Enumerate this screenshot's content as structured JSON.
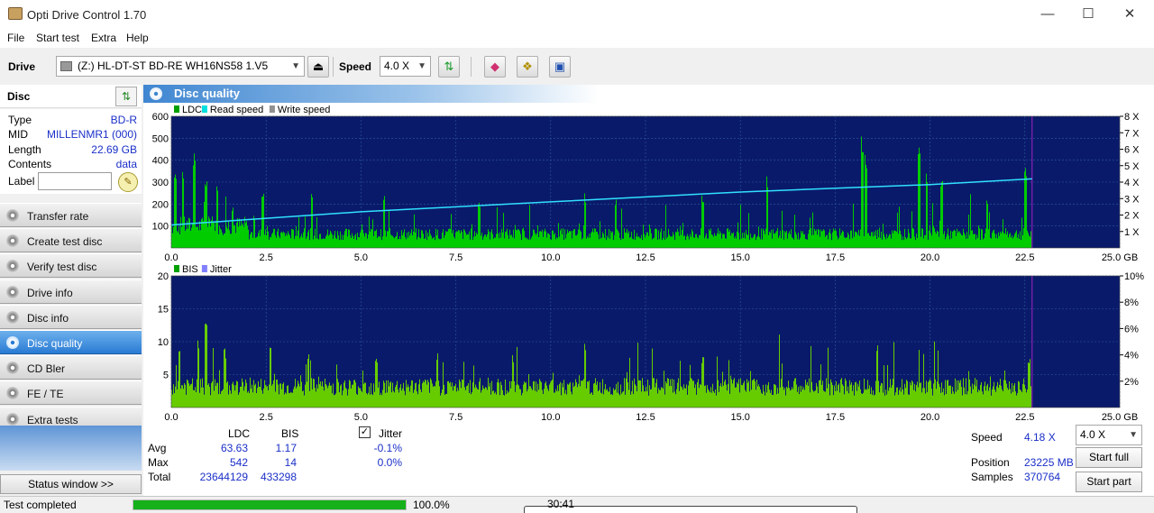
{
  "window": {
    "title": "Opti Drive Control 1.70",
    "minimize": "—",
    "maximize": "☐",
    "close": "✕"
  },
  "menu": [
    "File",
    "Start test",
    "Extra",
    "Help"
  ],
  "toolbar": {
    "drive_label": "Drive",
    "drive_value": "(Z:)   HL-DT-ST BD-RE  WH16NS58 1.V5",
    "speed_label": "Speed",
    "speed_value": "4.0 X",
    "icons": [
      "eject-icon",
      "refresh-icon",
      "eraser-icon",
      "copy-icon",
      "save-icon"
    ]
  },
  "disc": {
    "header": "Disc",
    "type_label": "Type",
    "type": "BD-R",
    "mid_label": "MID",
    "mid": "MILLENMR1 (000)",
    "length_label": "Length",
    "length": "22.69 GB",
    "contents_label": "Contents",
    "contents": "data",
    "label_label": "Label",
    "label_value": ""
  },
  "nav": [
    {
      "label": "Transfer rate",
      "active": false
    },
    {
      "label": "Create test disc",
      "active": false
    },
    {
      "label": "Verify test disc",
      "active": false
    },
    {
      "label": "Drive info",
      "active": false
    },
    {
      "label": "Disc info",
      "active": false
    },
    {
      "label": "Disc quality",
      "active": true
    },
    {
      "label": "CD Bler",
      "active": false
    },
    {
      "label": "FE / TE",
      "active": false
    },
    {
      "label": "Extra tests",
      "active": false
    }
  ],
  "status_window_button": "Status window >>",
  "panel_title": "Disc quality",
  "chart_data": [
    {
      "type": "area",
      "legend": [
        "LDC",
        "Read speed",
        "Write speed"
      ],
      "legend_colors": [
        "#00a000",
        "#00e0e0",
        "#909090"
      ],
      "x_ticks": [
        "0.0",
        "2.5",
        "5.0",
        "7.5",
        "10.0",
        "12.5",
        "15.0",
        "17.5",
        "20.0",
        "22.5",
        "25.0 GB"
      ],
      "y_ticks_left": [
        "600",
        "500",
        "400",
        "300",
        "200",
        "100"
      ],
      "y_ticks_right": [
        "8 X",
        "7 X",
        "6 X",
        "5 X",
        "4 X",
        "3 X",
        "2 X",
        "1 X"
      ],
      "xlim": [
        0,
        25
      ],
      "ylim": [
        0,
        600
      ],
      "y2lim": [
        0,
        8
      ],
      "data_end_gb": 22.69,
      "ldc_baseline": 60,
      "ldc_spikes": [
        [
          0.1,
          350
        ],
        [
          0.3,
          380
        ],
        [
          0.6,
          460
        ],
        [
          0.9,
          330
        ],
        [
          1.2,
          290
        ],
        [
          1.6,
          210
        ],
        [
          2.4,
          260
        ],
        [
          3.7,
          250
        ],
        [
          5.6,
          260
        ],
        [
          8.1,
          220
        ],
        [
          10.9,
          250
        ],
        [
          11.7,
          230
        ],
        [
          14.0,
          240
        ],
        [
          15.7,
          330
        ],
        [
          18.2,
          540
        ],
        [
          18.3,
          450
        ],
        [
          19.7,
          490
        ],
        [
          19.9,
          360
        ],
        [
          20.3,
          340
        ],
        [
          21.5,
          250
        ],
        [
          22.5,
          370
        ]
      ],
      "read_speed": [
        [
          0,
          1.4
        ],
        [
          5,
          2.2
        ],
        [
          10,
          2.8
        ],
        [
          15,
          3.4
        ],
        [
          20,
          3.85
        ],
        [
          22.69,
          4.2
        ]
      ],
      "colors": {
        "plot_bg": "#0a1a6a",
        "grid": "#2a5aa0",
        "ldc": "#00cc00",
        "read": "#30e0ff",
        "end_marker": "#a020c0"
      }
    },
    {
      "type": "area",
      "legend": [
        "BIS",
        "Jitter"
      ],
      "legend_colors": [
        "#00a000",
        "#8080ff"
      ],
      "x_ticks": [
        "0.0",
        "2.5",
        "5.0",
        "7.5",
        "10.0",
        "12.5",
        "15.0",
        "17.5",
        "20.0",
        "22.5",
        "25.0 GB"
      ],
      "y_ticks_left": [
        "20",
        "15",
        "10",
        "5"
      ],
      "y_ticks_right": [
        "10%",
        "8%",
        "6%",
        "4%",
        "2%"
      ],
      "xlim": [
        0,
        25
      ],
      "ylim": [
        0,
        20
      ],
      "y2lim": [
        0,
        10
      ],
      "data_end_gb": 22.69,
      "bis_baseline": 3,
      "bis_spikes": [
        [
          0.2,
          10
        ],
        [
          0.7,
          11
        ],
        [
          0.9,
          14
        ],
        [
          1.4,
          9
        ],
        [
          2.6,
          10
        ],
        [
          3.6,
          9
        ],
        [
          5.4,
          8
        ],
        [
          7.0,
          9
        ],
        [
          9.0,
          8
        ],
        [
          10.9,
          10
        ],
        [
          14.0,
          8
        ],
        [
          18.6,
          10
        ],
        [
          22.6,
          8
        ]
      ],
      "colors": {
        "plot_bg": "#0a1a6a",
        "grid": "#2a5aa0",
        "bis": "#66cc00",
        "end_marker": "#a020c0"
      }
    }
  ],
  "stats": {
    "col_ldc": "LDC",
    "col_bis": "BIS",
    "jitter_label": "Jitter",
    "jitter_checked": true,
    "avg_label": "Avg",
    "avg_ldc": "63.63",
    "avg_bis": "1.17",
    "avg_jitter": "-0.1%",
    "max_label": "Max",
    "max_ldc": "542",
    "max_bis": "14",
    "max_jitter": "0.0%",
    "total_label": "Total",
    "total_ldc": "23644129",
    "total_bis": "433298"
  },
  "right": {
    "speed_label": "Speed",
    "speed_value": "4.18 X",
    "speed_select": "4.0 X",
    "position_label": "Position",
    "position_value": "23225 MB",
    "samples_label": "Samples",
    "samples_value": "370764",
    "start_full": "Start full",
    "start_part": "Start part"
  },
  "status": {
    "text": "Test completed",
    "progress": 1.0,
    "percent": "100.0%",
    "time": "30:41"
  }
}
